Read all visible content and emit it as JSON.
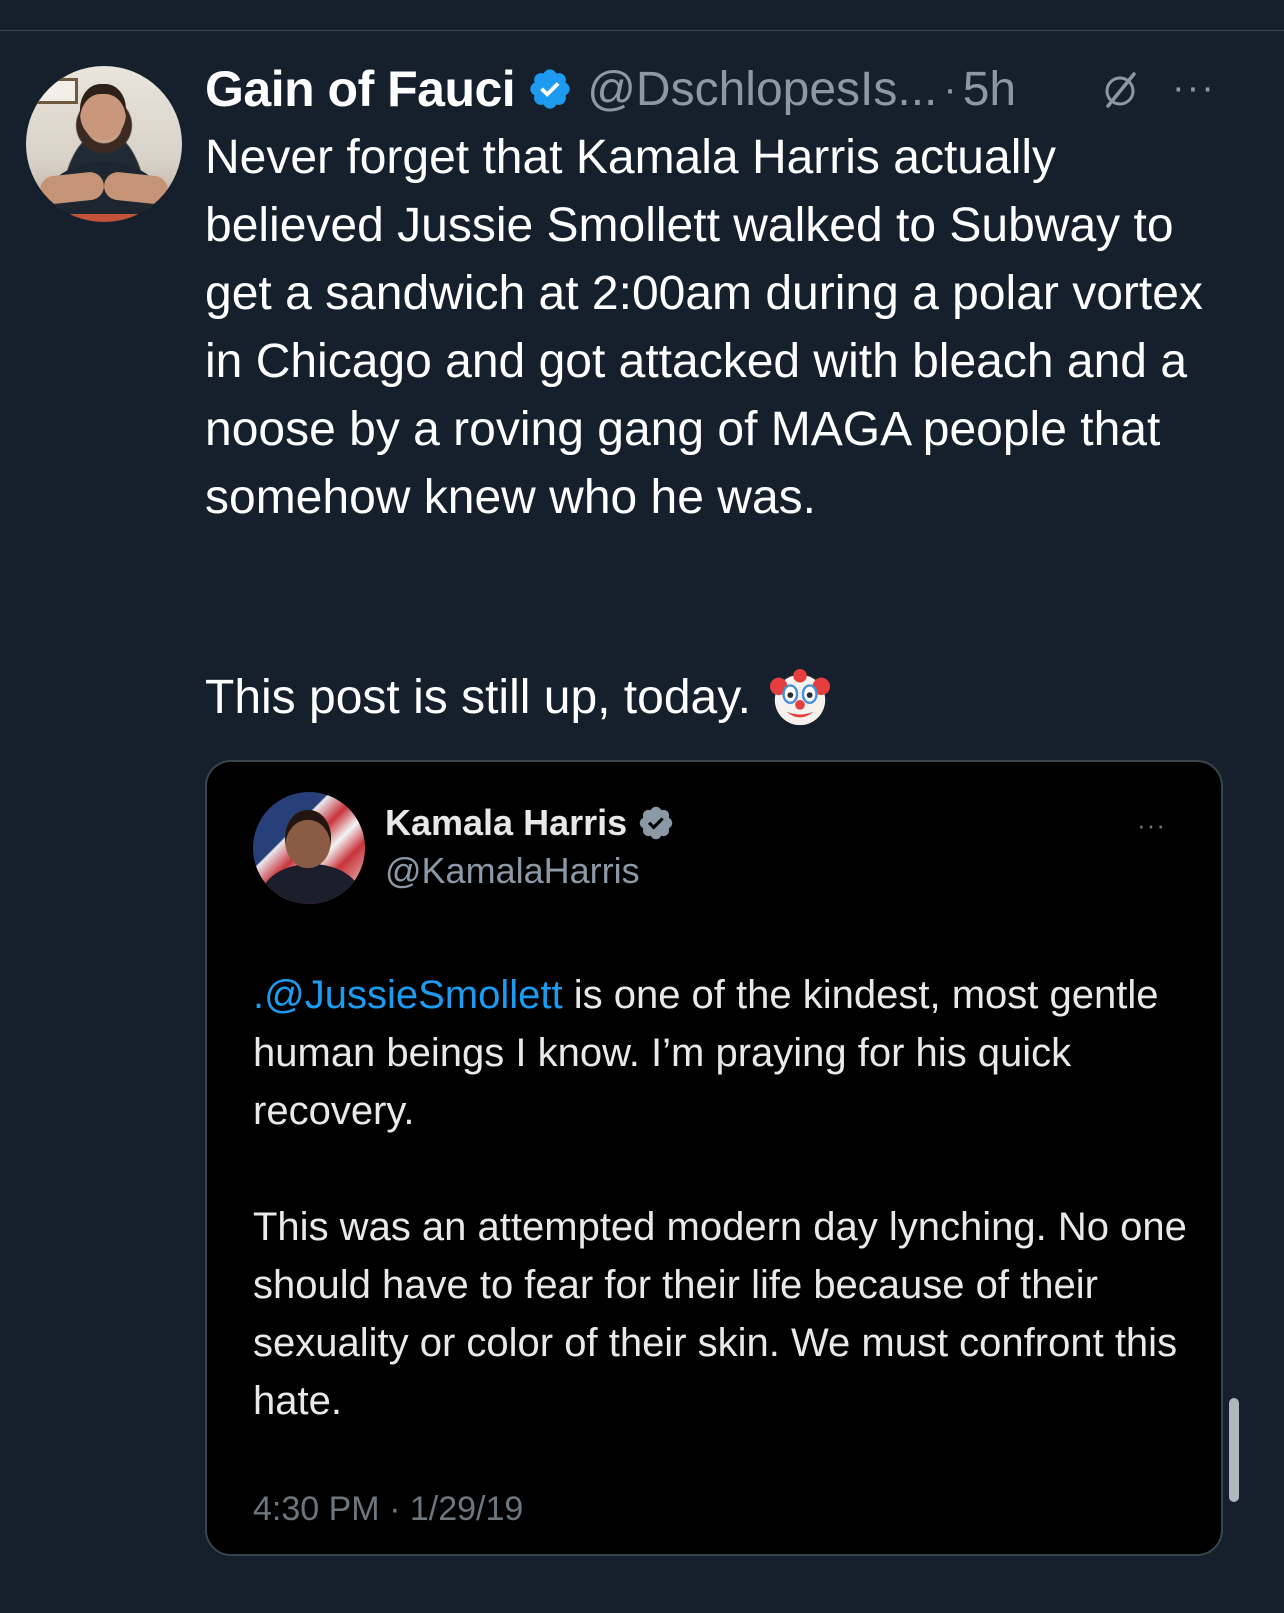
{
  "tweet": {
    "display_name": "Gain of Fauci",
    "verified_icon": "verified-badge-icon",
    "handle": "@DschlopesIs...",
    "separator": "·",
    "time": "5h",
    "body_paragraph_1": "Never forget that Kamala Harris actually believed Jussie Smollett walked to Subway to get a sandwich at 2:00am during a polar vortex in Chicago and got attacked with bleach and a noose by a roving gang of MAGA people that somehow knew who he was.",
    "body_paragraph_2": "This post is still up, today.",
    "emoji": "clown-face-emoji",
    "more_label": "···"
  },
  "quote": {
    "display_name": "Kamala Harris",
    "handle": "@KamalaHarris",
    "more_label": "···",
    "mention": ".@JussieSmollett",
    "paragraph_1_rest": " is one of the kindest, most gentle human beings I know. I’m praying for his quick recovery.",
    "paragraph_2": "This was an attempted modern day lynching. No one should have to fear for their life because of their sexuality or color of their skin. We must confront this hate.",
    "timestamp": "4:30 PM · 1/29/19"
  },
  "colors": {
    "background": "#16202c",
    "quote_background": "#000000",
    "accent_blue": "#1d9bf0",
    "secondary_text": "#8b98a5"
  }
}
